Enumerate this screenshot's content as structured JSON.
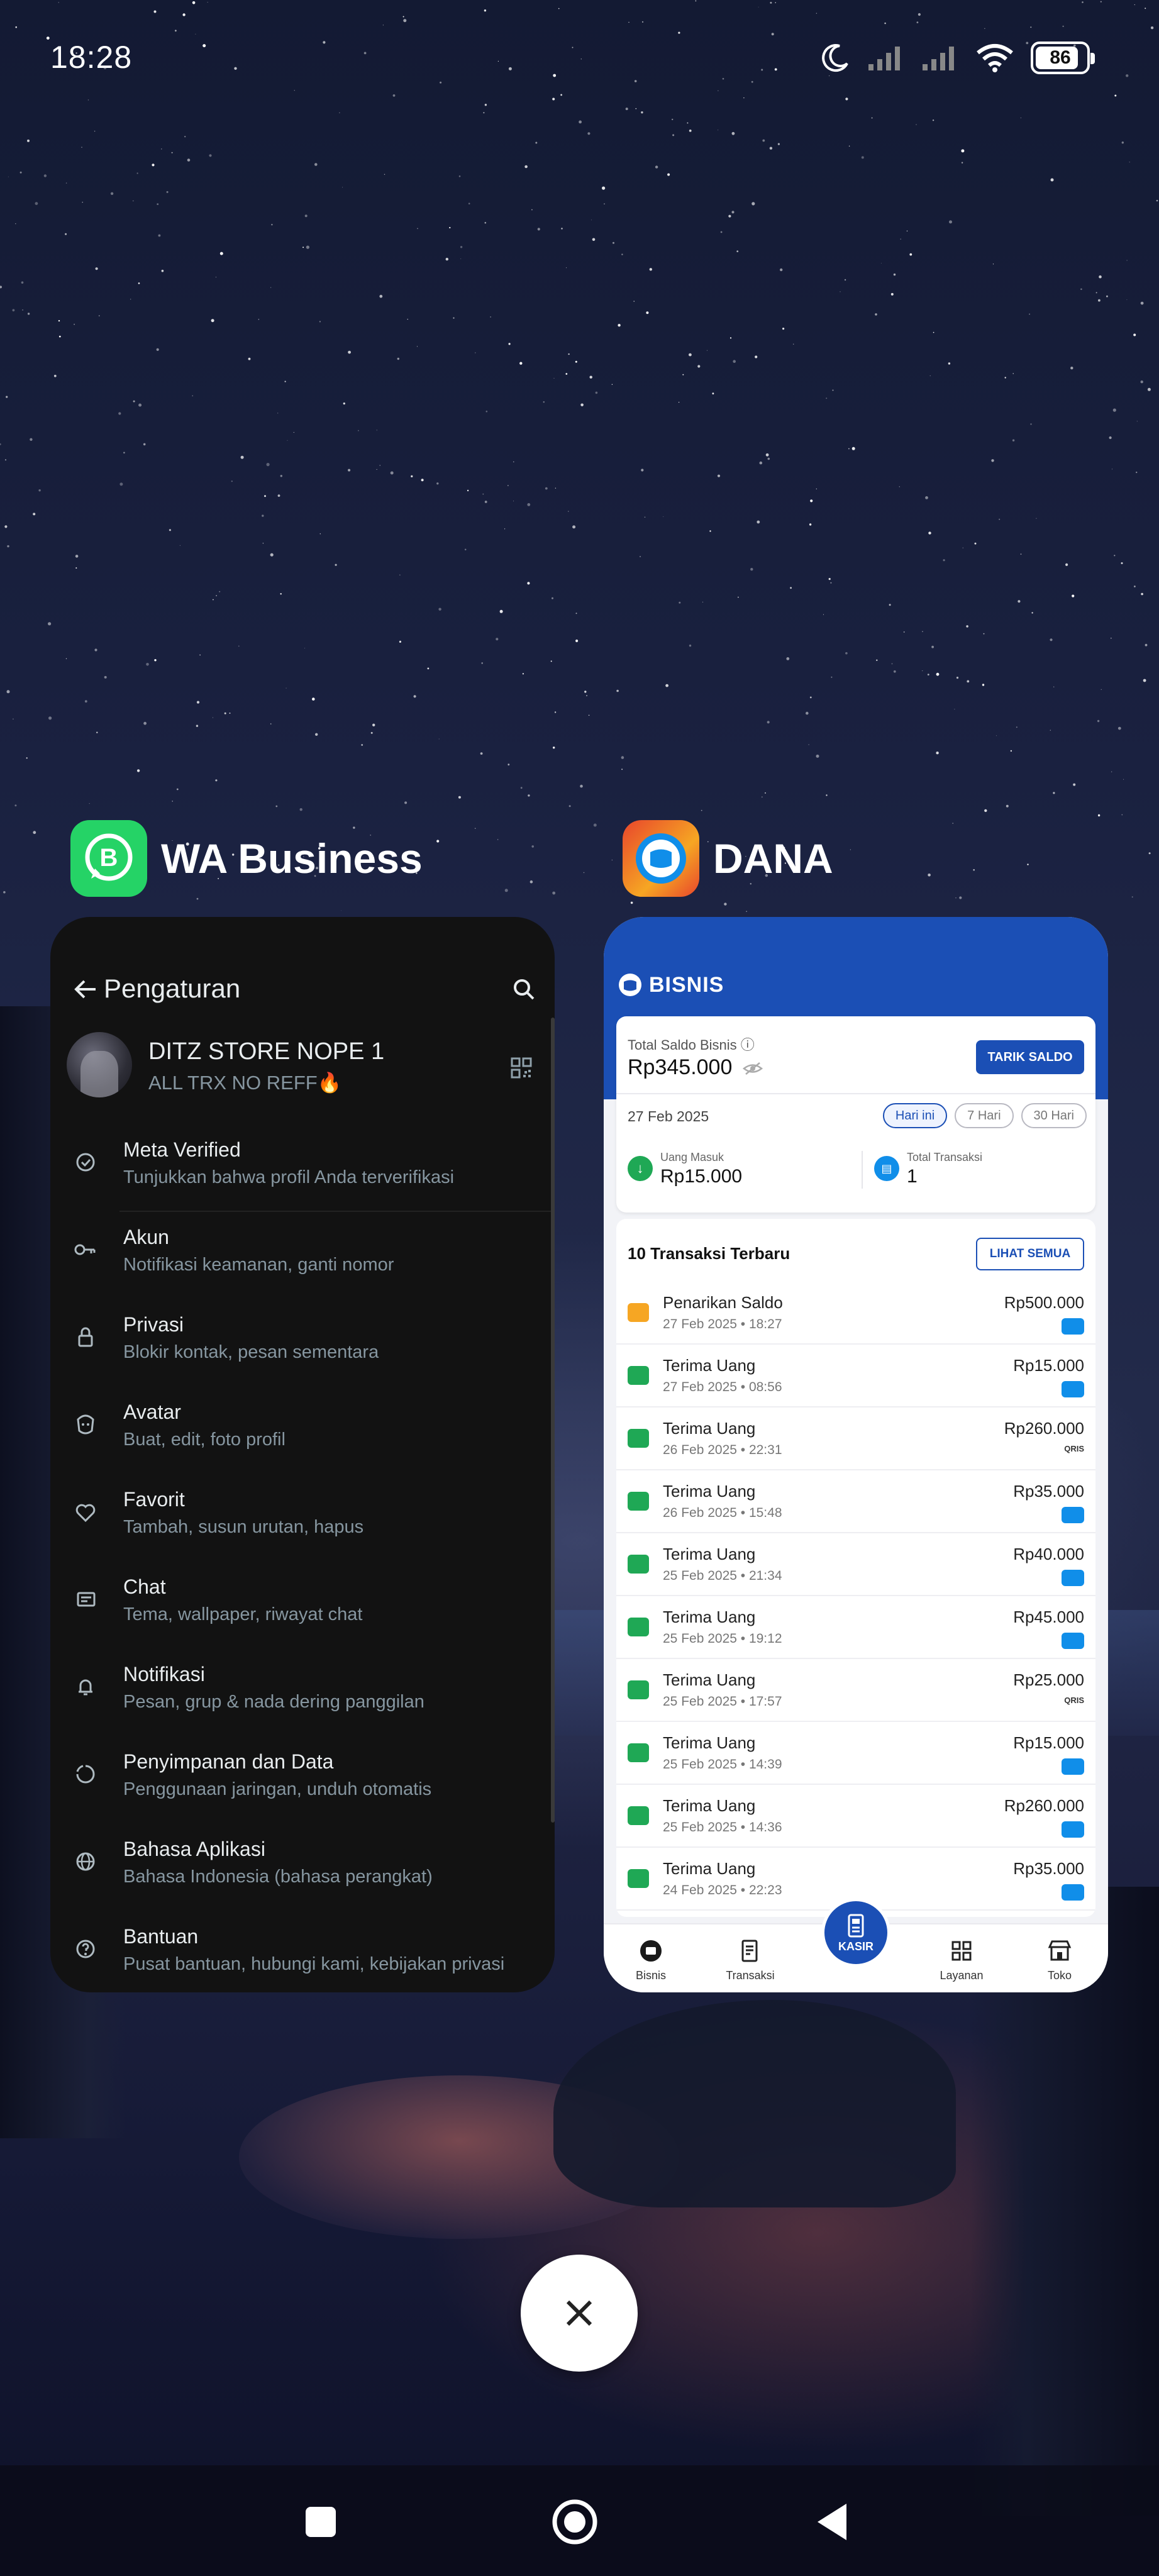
{
  "status_bar": {
    "time": "18:28",
    "battery": "86",
    "battery_level": 0.86
  },
  "recents": {
    "apps": [
      {
        "name": "WA Business",
        "icon": "whatsapp-business-icon",
        "accent": "#25d366"
      },
      {
        "name": "DANA",
        "icon": "dana-icon",
        "accent": "#108ee9"
      }
    ]
  },
  "wa": {
    "title": "Pengaturan",
    "profile": {
      "name": "DITZ STORE NOPE 1",
      "about": "ALL TRX NO REFF🔥"
    },
    "items": [
      {
        "title": "Meta Verified",
        "subtitle": "Tunjukkan bahwa profil Anda terverifikasi",
        "icon": "verified-badge-icon"
      },
      {
        "title": "Akun",
        "subtitle": "Notifikasi keamanan, ganti nomor",
        "icon": "key-icon"
      },
      {
        "title": "Privasi",
        "subtitle": "Blokir kontak, pesan sementara",
        "icon": "lock-icon"
      },
      {
        "title": "Avatar",
        "subtitle": "Buat, edit, foto profil",
        "icon": "avatar-face-icon"
      },
      {
        "title": "Favorit",
        "subtitle": "Tambah, susun urutan, hapus",
        "icon": "heart-icon"
      },
      {
        "title": "Chat",
        "subtitle": "Tema, wallpaper, riwayat chat",
        "icon": "chat-icon"
      },
      {
        "title": "Notifikasi",
        "subtitle": "Pesan, grup & nada dering panggilan",
        "icon": "bell-icon"
      },
      {
        "title": "Penyimpanan dan Data",
        "subtitle": "Penggunaan jaringan, unduh otomatis",
        "icon": "data-usage-icon"
      },
      {
        "title": "Bahasa Aplikasi",
        "subtitle": "Bahasa Indonesia (bahasa perangkat)",
        "icon": "globe-icon"
      },
      {
        "title": "Bantuan",
        "subtitle": "Pusat bantuan, hubungi kami, kebijakan privasi",
        "icon": "help-icon"
      }
    ]
  },
  "dana": {
    "logo_text": "BISNIS",
    "saldo_label": "Total Saldo Bisnis ⓘ",
    "saldo_value": "Rp345.000",
    "tarik_label": "TARIK SALDO",
    "date": "27 Feb 2025",
    "chips": [
      "Hari ini",
      "7 Hari",
      "30 Hari"
    ],
    "uang_masuk_label": "Uang Masuk",
    "uang_masuk_value": "Rp15.000",
    "total_transaksi_label": "Total Transaksi",
    "total_transaksi_value": "1",
    "tx_header": "10 Transaksi Terbaru",
    "lihat_label": "LIHAT SEMUA",
    "transactions": [
      {
        "title": "Penarikan Saldo",
        "date": "27 Feb 2025 • 18:27",
        "amount": "Rp500.000",
        "kind": "withdraw",
        "method": "dana"
      },
      {
        "title": "Terima Uang",
        "date": "27 Feb 2025 • 08:56",
        "amount": "Rp15.000",
        "kind": "receive",
        "method": "dana"
      },
      {
        "title": "Terima Uang",
        "date": "26 Feb 2025 • 22:31",
        "amount": "Rp260.000",
        "kind": "receive",
        "method": "qris"
      },
      {
        "title": "Terima Uang",
        "date": "26 Feb 2025 • 15:48",
        "amount": "Rp35.000",
        "kind": "receive",
        "method": "dana"
      },
      {
        "title": "Terima Uang",
        "date": "25 Feb 2025 • 21:34",
        "amount": "Rp40.000",
        "kind": "receive",
        "method": "dana"
      },
      {
        "title": "Terima Uang",
        "date": "25 Feb 2025 • 19:12",
        "amount": "Rp45.000",
        "kind": "receive",
        "method": "dana"
      },
      {
        "title": "Terima Uang",
        "date": "25 Feb 2025 • 17:57",
        "amount": "Rp25.000",
        "kind": "receive",
        "method": "qris"
      },
      {
        "title": "Terima Uang",
        "date": "25 Feb 2025 • 14:39",
        "amount": "Rp15.000",
        "kind": "receive",
        "method": "dana"
      },
      {
        "title": "Terima Uang",
        "date": "25 Feb 2025 • 14:36",
        "amount": "Rp260.000",
        "kind": "receive",
        "method": "dana"
      },
      {
        "title": "Terima Uang",
        "date": "24 Feb 2025 • 22:23",
        "amount": "Rp35.000",
        "kind": "receive",
        "method": "dana"
      }
    ],
    "qris_label": "QRIS",
    "nav": [
      {
        "label": "Bisnis",
        "icon": "store-icon"
      },
      {
        "label": "Transaksi",
        "icon": "receipt-icon"
      },
      {
        "label": "KASIR",
        "icon": "cashier-icon"
      },
      {
        "label": "Layanan",
        "icon": "grid-icon"
      },
      {
        "label": "Toko",
        "icon": "shop-icon"
      }
    ]
  }
}
